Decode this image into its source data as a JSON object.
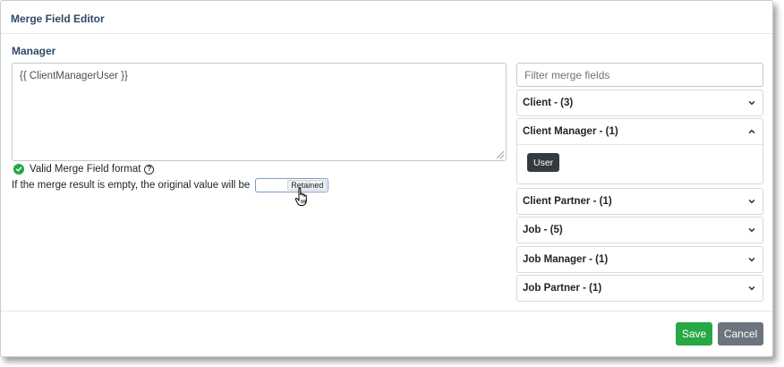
{
  "modal": {
    "title": "Merge Field Editor"
  },
  "field": {
    "label": "Manager",
    "value": "{{ ClientManagerUser }}"
  },
  "validation": {
    "message": "Valid Merge Field format",
    "help_glyph": "?"
  },
  "empty_behavior": {
    "text": "If the merge result is empty, the original value will be",
    "toggle_value": "Retained"
  },
  "filter": {
    "placeholder": "Filter merge fields"
  },
  "groups": [
    {
      "label": "Client - (3)",
      "expanded": false
    },
    {
      "label": "Client Manager - (1)",
      "expanded": true,
      "items": [
        "User"
      ]
    },
    {
      "label": "Client Partner - (1)",
      "expanded": false
    },
    {
      "label": "Job - (5)",
      "expanded": false
    },
    {
      "label": "Job Manager - (1)",
      "expanded": false
    },
    {
      "label": "Job Partner - (1)",
      "expanded": false
    }
  ],
  "footer": {
    "save_label": "Save",
    "cancel_label": "Cancel"
  },
  "colors": {
    "title": "#2f4a66",
    "success": "#28a745",
    "secondary": "#6c757d",
    "dark": "#343a40"
  },
  "icons": {
    "valid": "check-circle-icon",
    "help": "question-circle-icon",
    "collapsed": "chevron-down-icon",
    "expanded": "chevron-up-icon",
    "cursor": "hand-pointer-icon"
  }
}
